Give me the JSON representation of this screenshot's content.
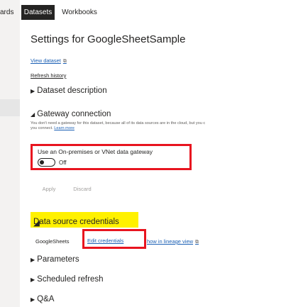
{
  "tabs": [
    {
      "label": "ards",
      "active": false
    },
    {
      "label": "Datasets",
      "active": true
    },
    {
      "label": "Workbooks",
      "active": false
    }
  ],
  "settings": {
    "title": "Settings for GoogleSheetSample",
    "view_dataset": "View dataset",
    "refresh_history": "Refresh history"
  },
  "sections": {
    "dataset_description": "Dataset description",
    "gateway_connection": "Gateway connection",
    "data_source_credentials": "Data source credentials",
    "parameters": "Parameters",
    "scheduled_refresh": "Scheduled refresh",
    "qa": "Q&A"
  },
  "gateway": {
    "note_line1": "You don't need a gateway for this dataset, because all of its data sources are in the cloud, but you c",
    "note_line2": "you connect.",
    "learn_more": "Learn more",
    "option_label": "Use an On-premises or VNet data gateway",
    "toggle_state": "Off",
    "apply": "Apply",
    "discard": "Discard"
  },
  "credentials": {
    "source_name": "GoogleSheets",
    "edit_credentials": "Edit credentials",
    "lineage_link": "how in lineage view"
  },
  "colors": {
    "highlight_red": "#e8141f",
    "highlight_yellow": "#fff100",
    "link_blue": "#1a5fb4",
    "active_tab": "#252423"
  },
  "icons": {
    "external_link": "external-link-icon",
    "collapsed": "triangle-right-icon",
    "expanded": "triangle-down-icon"
  }
}
